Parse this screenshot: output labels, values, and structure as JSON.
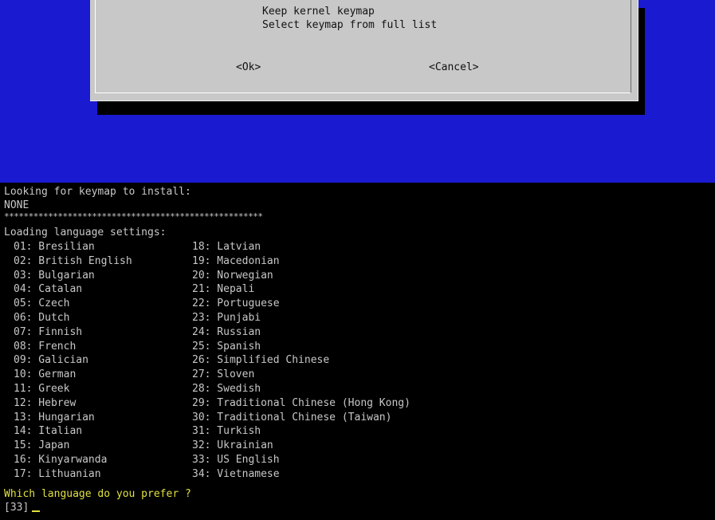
{
  "dialog": {
    "options": [
      "Keep kernel keymap",
      "Select keymap from full list"
    ],
    "ok_label": "<Ok>",
    "cancel_label": "<Cancel>"
  },
  "terminal": {
    "looking_line": "Looking for keymap to install:",
    "none_line": "NONE",
    "stars_line": "*****************************************************",
    "loading_line": "Loading language settings:",
    "languages_left": [
      "01: Bresilian",
      "02: British English",
      "03: Bulgarian",
      "04: Catalan",
      "05: Czech",
      "06: Dutch",
      "07: Finnish",
      "08: French",
      "09: Galician",
      "10: German",
      "11: Greek",
      "12: Hebrew",
      "13: Hungarian",
      "14: Italian",
      "15: Japan",
      "16: Kinyarwanda",
      "17: Lithuanian"
    ],
    "languages_right": [
      "18: Latvian",
      "19: Macedonian",
      "20: Norwegian",
      "21: Nepali",
      "22: Portuguese",
      "23: Punjabi",
      "24: Russian",
      "25: Spanish",
      "26: Simplified Chinese",
      "27: Sloven",
      "28: Swedish",
      "29: Traditional Chinese (Hong Kong)",
      "30: Traditional Chinese (Taiwan)",
      "31: Turkish",
      "32: Ukrainian",
      "33: US English",
      "34: Vietnamese"
    ],
    "prompt": "Which language do you prefer ?",
    "input_value": "[33]"
  },
  "colors": {
    "dialog_background_blue": "#1a1ad0",
    "dialog_gray": "#c8c8c8",
    "terminal_text": "#c8c8c8",
    "prompt_yellow": "#e0e040"
  }
}
